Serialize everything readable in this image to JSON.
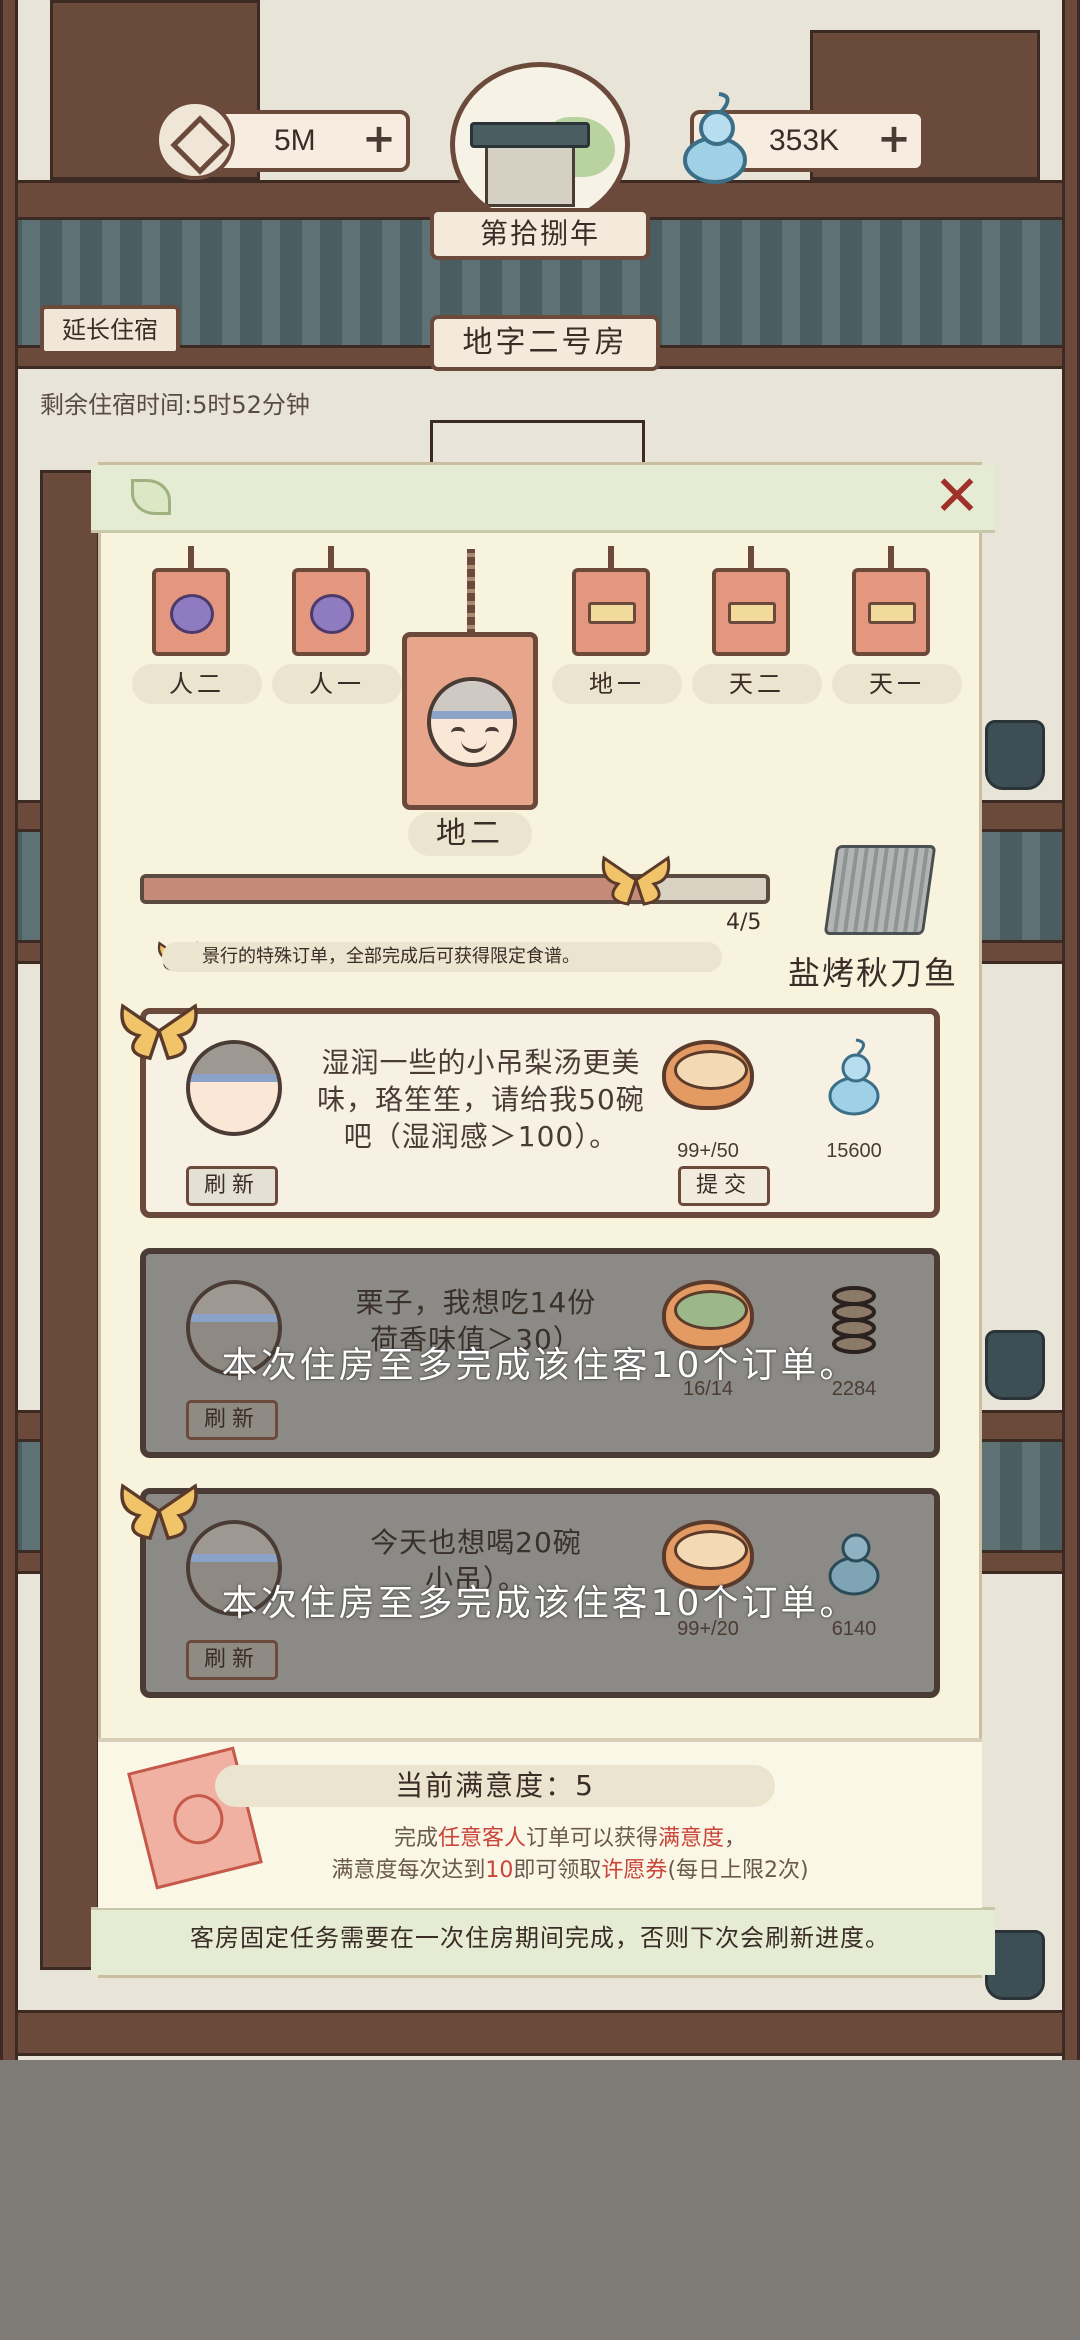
{
  "hud": {
    "coins": "5M",
    "spirit": "353K",
    "plus": "+",
    "year": "第拾捌年"
  },
  "room": {
    "extend_label": "延长住宿",
    "name": "地字二号房",
    "remaining": "剩余住宿时间:5时52分钟"
  },
  "panel": {
    "close": "✕",
    "tags": [
      {
        "label": "人二",
        "icon": "purple-fruit-icon"
      },
      {
        "label": "人一",
        "icon": "purple-fruit-icon"
      },
      {
        "label": "地一",
        "icon": "tray-icon"
      },
      {
        "label": "天二",
        "icon": "tray-icon"
      },
      {
        "label": "天一",
        "icon": "tray-icon"
      }
    ],
    "active_tag": "地二",
    "progress": {
      "current": 4,
      "total": 5,
      "text": "4/5"
    },
    "quest_note": "景行的特殊订单，全部完成后可获得限定食谱。",
    "recipe_name": "盐烤秋刀鱼"
  },
  "orders": [
    {
      "request": "湿润一些的小吊梨汤更美味，珞笙笙，请给我50碗吧（湿润感＞100）。",
      "count": "99+/50",
      "reward": "15600",
      "refresh": "刷新",
      "submit": "提交",
      "dim": false
    },
    {
      "request": "栗子，我想吃14份荷香味值＞30）",
      "count": "16/14",
      "reward": "2284",
      "refresh": "刷新",
      "dim": true
    },
    {
      "request": "今天也想喝20碗小吊）。",
      "count": "99+/20",
      "reward": "6140",
      "refresh": "刷新",
      "dim": true
    }
  ],
  "toasts": [
    "本次住房至多完成该住客10个订单。",
    "本次住房至多完成该住客10个订单。"
  ],
  "satisfaction": {
    "title": "当前满意度：5",
    "line1_a": "完成",
    "line1_b": "任意客人",
    "line1_c": "订单可以获得",
    "line1_d": "满意度",
    "line1_e": "，",
    "line2_a": "满意度每次达到",
    "line2_b": "10",
    "line2_c": "即可领取",
    "line2_d": "许愿券",
    "line2_e": "(每日上限2次)"
  },
  "footer_note": "客房固定任务需要在一次住房期间完成，否则下次会刷新进度。",
  "colors": {
    "accent": "#c9453a",
    "frame": "#6b4a3c",
    "panel": "#f8f3dd"
  }
}
